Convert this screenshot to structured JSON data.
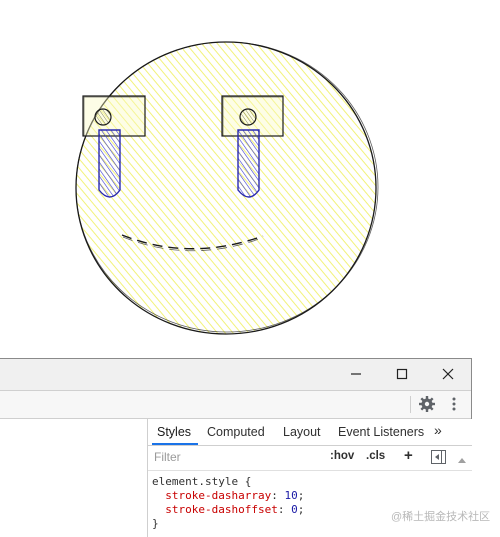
{
  "window": {
    "minimize_icon": "minimize-icon",
    "maximize_icon": "maximize-icon",
    "close_icon": "close-icon"
  },
  "toolbar": {
    "settings_icon": "gear-icon",
    "more_icon": "kebab-menu-icon"
  },
  "tabs": [
    {
      "label": "Styles",
      "active": true
    },
    {
      "label": "Computed",
      "active": false
    },
    {
      "label": "Layout",
      "active": false
    },
    {
      "label": "Event Listeners",
      "active": false
    }
  ],
  "tabs_overflow": "»",
  "filter": {
    "placeholder": "Filter",
    "hov": ":hov",
    "cls": ".cls",
    "add": "+"
  },
  "code": {
    "selector": "element.style {",
    "props": [
      {
        "name": "stroke-dasharray",
        "value": "10"
      },
      {
        "name": "stroke-dashoffset",
        "value": "0"
      }
    ],
    "close": "}"
  },
  "watermark": "@稀土掘金技术社区",
  "colors": {
    "face_fill": "#fafaa0",
    "tears": "#3030c8",
    "accent": "#1a73e8"
  }
}
